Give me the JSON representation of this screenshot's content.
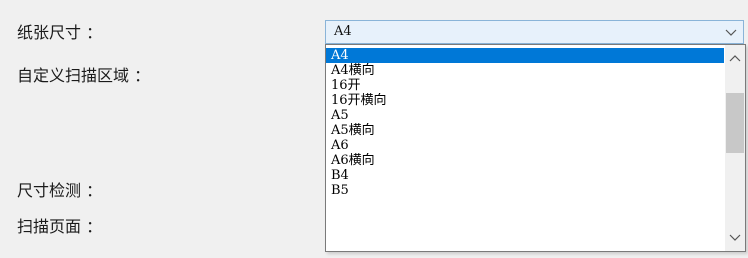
{
  "form": {
    "paper_size_label": "纸张尺寸 ：",
    "custom_area_label": "自定义扫描区域 ：",
    "size_detect_label": "尺寸检测 ：",
    "scan_pages_label": "扫描页面 ："
  },
  "paper_size": {
    "selected": "A4",
    "options": [
      "A4",
      "A4横向",
      "16开",
      "16开横向",
      "A5",
      "A5横向",
      "A6",
      "A6横向",
      "B4",
      "B5"
    ],
    "highlighted_index": 0,
    "scroll_position": 0.0
  },
  "icons": {
    "combo_arrow": "chevron-down-icon",
    "scroll_up": "chevron-up-icon",
    "scroll_down": "chevron-down-icon"
  },
  "colors": {
    "combo_bg": "#e7f1fb",
    "combo_border": "#8ab4d8",
    "selection": "#0078d7"
  }
}
